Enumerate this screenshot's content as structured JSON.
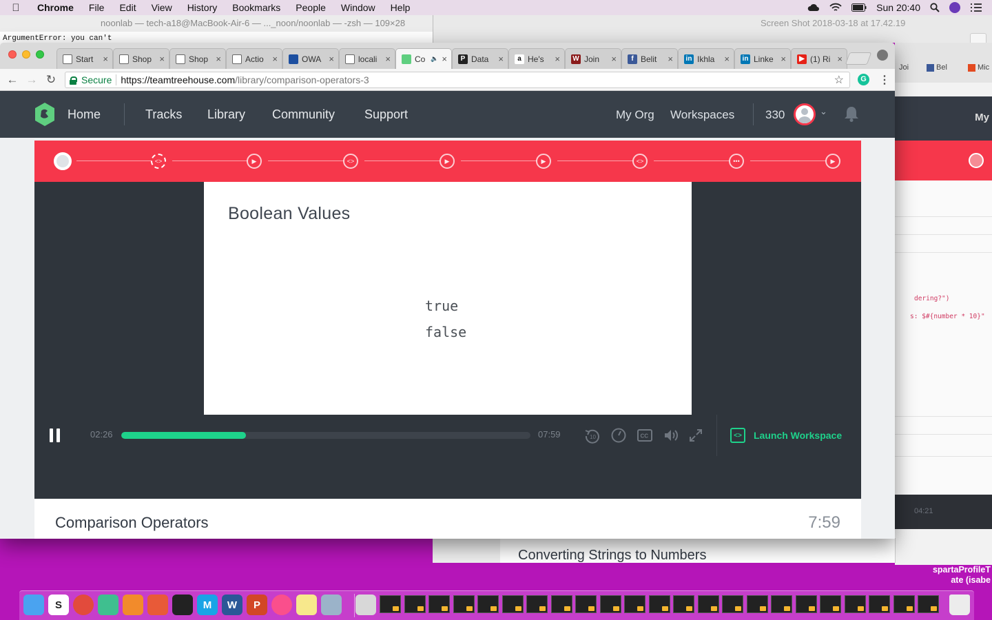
{
  "menubar": {
    "app": "Chrome",
    "items": [
      "File",
      "Edit",
      "View",
      "History",
      "Bookmarks",
      "People",
      "Window",
      "Help"
    ],
    "clock": "Sun 20:40"
  },
  "background": {
    "terminal_title": "noonlab — tech-a18@MacBook-Air-6 — ..._noon/noonlab — -zsh — 109×28",
    "terminal_output": "ArgumentError: you can't",
    "preview_title": "Screen Shot 2018-03-18 at 17.42.19",
    "browser_tabs": [
      "Joi",
      "Bel",
      "Mic"
    ],
    "browser_nav_label": "My",
    "code_line_1": "dering?\")",
    "code_line_2": "s: $#{number * 10}\"",
    "player_time": "04:21",
    "lower_title": "Converting Strings to Numbers",
    "desktop_label_line1": "spartaProfileT",
    "desktop_label_line2": "ate (isabe"
  },
  "browser": {
    "tabs": [
      {
        "label": "Start",
        "favicon": "doc-icon"
      },
      {
        "label": "Shop",
        "favicon": "doc-icon"
      },
      {
        "label": "Shop",
        "favicon": "doc-icon"
      },
      {
        "label": "Actio",
        "favicon": "doc-icon"
      },
      {
        "label": "OWA",
        "favicon": "owa-icon"
      },
      {
        "label": "locali",
        "favicon": "doc-icon"
      },
      {
        "label": "Co",
        "favicon": "treehouse-icon",
        "active": true
      },
      {
        "label": "Data",
        "favicon": "p-icon"
      },
      {
        "label": "He's",
        "favicon": "amazon-icon"
      },
      {
        "label": "Join",
        "favicon": "w-icon"
      },
      {
        "label": "Belit",
        "favicon": "facebook-icon"
      },
      {
        "label": "Ikhla",
        "favicon": "linkedin-icon"
      },
      {
        "label": "Linke",
        "favicon": "linkedin-icon"
      },
      {
        "label": "(1) Ri",
        "favicon": "youtube-icon"
      }
    ],
    "secure_label": "Secure",
    "url_host": "https://teamtreehouse.com",
    "url_path": "/library/comparison-operators-3",
    "accent": "#0b8043"
  },
  "site": {
    "nav": {
      "home": "Home",
      "links": [
        "Tracks",
        "Library",
        "Community",
        "Support"
      ],
      "my_org": "My Org",
      "workspaces": "Workspaces",
      "points": "330"
    },
    "colors": {
      "brand_red": "#f6374b",
      "green": "#1ed28b",
      "dark": "#384049"
    },
    "player": {
      "slide_title": "Boolean Values",
      "code_lines": [
        "true",
        "false"
      ],
      "current_time": "02:26",
      "total_time": "07:59",
      "progress_fraction": 0.305,
      "launch_label": "Launch Workspace"
    },
    "video": {
      "title": "Comparison Operators",
      "duration": "7:59"
    }
  }
}
